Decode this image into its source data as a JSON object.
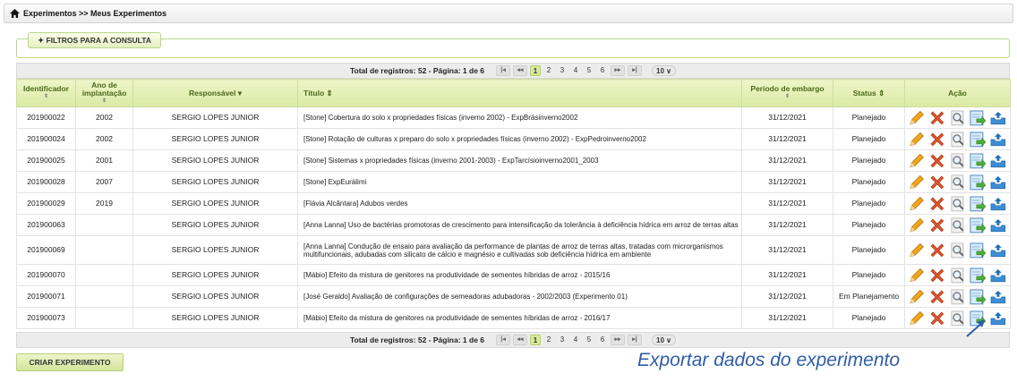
{
  "breadcrumb": {
    "text": "Experimentos >> Meus Experimentos"
  },
  "filters": {
    "label": "✦ FILTROS PARA A CONSULTA"
  },
  "pager": {
    "total_text": "Total de registros: 52 - Página: 1 de 6",
    "first": "|◂",
    "prev": "◂◂",
    "next": "▸▸",
    "last": "▸|",
    "pages": [
      "1",
      "2",
      "3",
      "4",
      "5",
      "6"
    ],
    "active_page": "1",
    "per_page": "10 ∨"
  },
  "table": {
    "columns": {
      "id": "Identificador",
      "year": "Ano de implantação",
      "responsible": "Responsável ▾",
      "title": "Título ⇕",
      "embargo": "Período de embargo",
      "status": "Status ⇕",
      "action": "Ação"
    },
    "sort_glyph": "⇕",
    "rows": [
      {
        "id": "201900022",
        "year": "2002",
        "resp": "SERGIO LOPES JUNIOR",
        "title": "[Stone] Cobertura do solo x propriedades físicas (inverno 2002) - ExpBrásinverno2002",
        "embargo": "31/12/2021",
        "status": "Planejado"
      },
      {
        "id": "201900024",
        "year": "2002",
        "resp": "SERGIO LOPES JUNIOR",
        "title": "[Stone] Rotação de culturas x preparo do solo x propriedades físicas (inverno 2002) - ExpPedroinverno2002",
        "embargo": "31/12/2021",
        "status": "Planejado"
      },
      {
        "id": "201900025",
        "year": "2001",
        "resp": "SERGIO LOPES JUNIOR",
        "title": "[Stone] Sistemas x propriedades físicas (inverno 2001-2003) - ExpTarcísioinverno2001_2003",
        "embargo": "31/12/2021",
        "status": "Planejado"
      },
      {
        "id": "201900028",
        "year": "2007",
        "resp": "SERGIO LOPES JUNIOR",
        "title": "[Stone] ExpEurálimi",
        "embargo": "31/12/2021",
        "status": "Planejado"
      },
      {
        "id": "201900029",
        "year": "2019",
        "resp": "SERGIO LOPES JUNIOR",
        "title": "[Flávia Alcântara] Adubos verdes",
        "embargo": "31/12/2021",
        "status": "Planejado"
      },
      {
        "id": "201900063",
        "year": "",
        "resp": "SERGIO LOPES JUNIOR",
        "title": "[Anna Lanna] Uso de bactérias promotoras de crescimento para intensificação da tolerância à deficiência hídrica em arroz de terras altas",
        "embargo": "31/12/2021",
        "status": "Planejado"
      },
      {
        "id": "201900069",
        "year": "",
        "resp": "SERGIO LOPES JUNIOR",
        "title": "[Anna Lanna] Condução de ensaio para avaliação da performance de plantas de arroz de terras altas, tratadas com microrganismos multifuncionais, adubadas com silicato de cálcio e magnésio e cultivadas sob deficiência hídrica em ambiente",
        "embargo": "31/12/2021",
        "status": "Planejado"
      },
      {
        "id": "201900070",
        "year": "",
        "resp": "SERGIO LOPES JUNIOR",
        "title": "[Mábio] Efeito da mistura de genitores na produtividade de sementes híbridas de arroz - 2015/16",
        "embargo": "31/12/2021",
        "status": "Planejado"
      },
      {
        "id": "201900071",
        "year": "",
        "resp": "SERGIO LOPES JUNIOR",
        "title": "[José Geraldo] Avaliação de configurações de semeadoras adubadoras - 2002/2003 (Experimento 01)",
        "embargo": "31/12/2021",
        "status": "Em Planejamento"
      },
      {
        "id": "201900073",
        "year": "",
        "resp": "SERGIO LOPES JUNIOR",
        "title": "[Mábio] Efeito da mistura de genitores na produtividade de sementes híbridas de arroz - 2016/17",
        "embargo": "31/12/2021",
        "status": "Planejado"
      }
    ]
  },
  "create_button": "CRIAR EXPERIMENTO",
  "annotation": "Exportar dados do experimento",
  "icons": [
    "home-icon",
    "edit-pencil-icon",
    "delete-x-icon",
    "view-magnifier-icon",
    "export-document-icon",
    "upload-tray-icon"
  ],
  "colors": {
    "header_text": "#4a6a1a",
    "header_bg": "#dbe9a3",
    "accent_blue": "#2f5da8"
  }
}
